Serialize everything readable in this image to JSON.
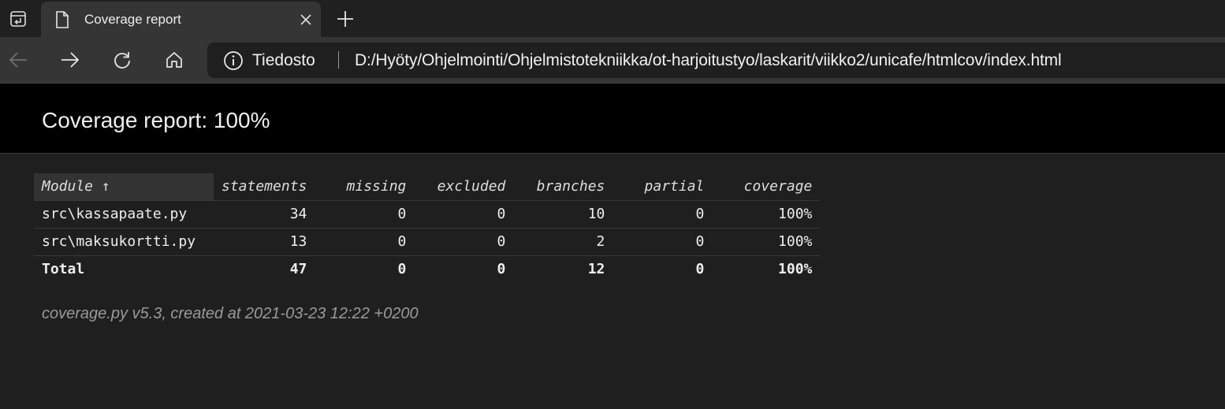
{
  "browser": {
    "tab": {
      "title": "Coverage report",
      "favicon": "page-icon",
      "close_icon": "close-icon"
    },
    "new_tab_icon": "plus-icon",
    "tab_actions_icon": "tab-actions-icon",
    "toolbar": {
      "back_icon": "back-arrow-icon",
      "forward_icon": "forward-arrow-icon",
      "refresh_icon": "refresh-icon",
      "home_icon": "home-icon"
    },
    "address_bar": {
      "info_icon": "info-icon",
      "label": "Tiedosto",
      "url": "D:/Hyöty/Ohjelmointi/Ohjelmistotekniikka/ot-harjoitustyo/laskarit/viikko2/unicafe/htmlcov/index.html"
    }
  },
  "report": {
    "title": "Coverage report: 100%",
    "columns": {
      "module": "Module ↑",
      "statements": "statements",
      "missing": "missing",
      "excluded": "excluded",
      "branches": "branches",
      "partial": "partial",
      "coverage": "coverage"
    },
    "rows": [
      {
        "module": "src\\kassapaate.py",
        "statements": "34",
        "missing": "0",
        "excluded": "0",
        "branches": "10",
        "partial": "0",
        "coverage": "100%"
      },
      {
        "module": "src\\maksukortti.py",
        "statements": "13",
        "missing": "0",
        "excluded": "0",
        "branches": "2",
        "partial": "0",
        "coverage": "100%"
      }
    ],
    "total": {
      "module": "Total",
      "statements": "47",
      "missing": "0",
      "excluded": "0",
      "branches": "12",
      "partial": "0",
      "coverage": "100%"
    },
    "footer": "coverage.py v5.3, created at 2021-03-23 12:22 +0200"
  },
  "colors": {
    "page_background": "#1f1f1f",
    "header_background": "#000000",
    "toolbar_background": "#353535",
    "footer_text": "#9a9a9a"
  }
}
